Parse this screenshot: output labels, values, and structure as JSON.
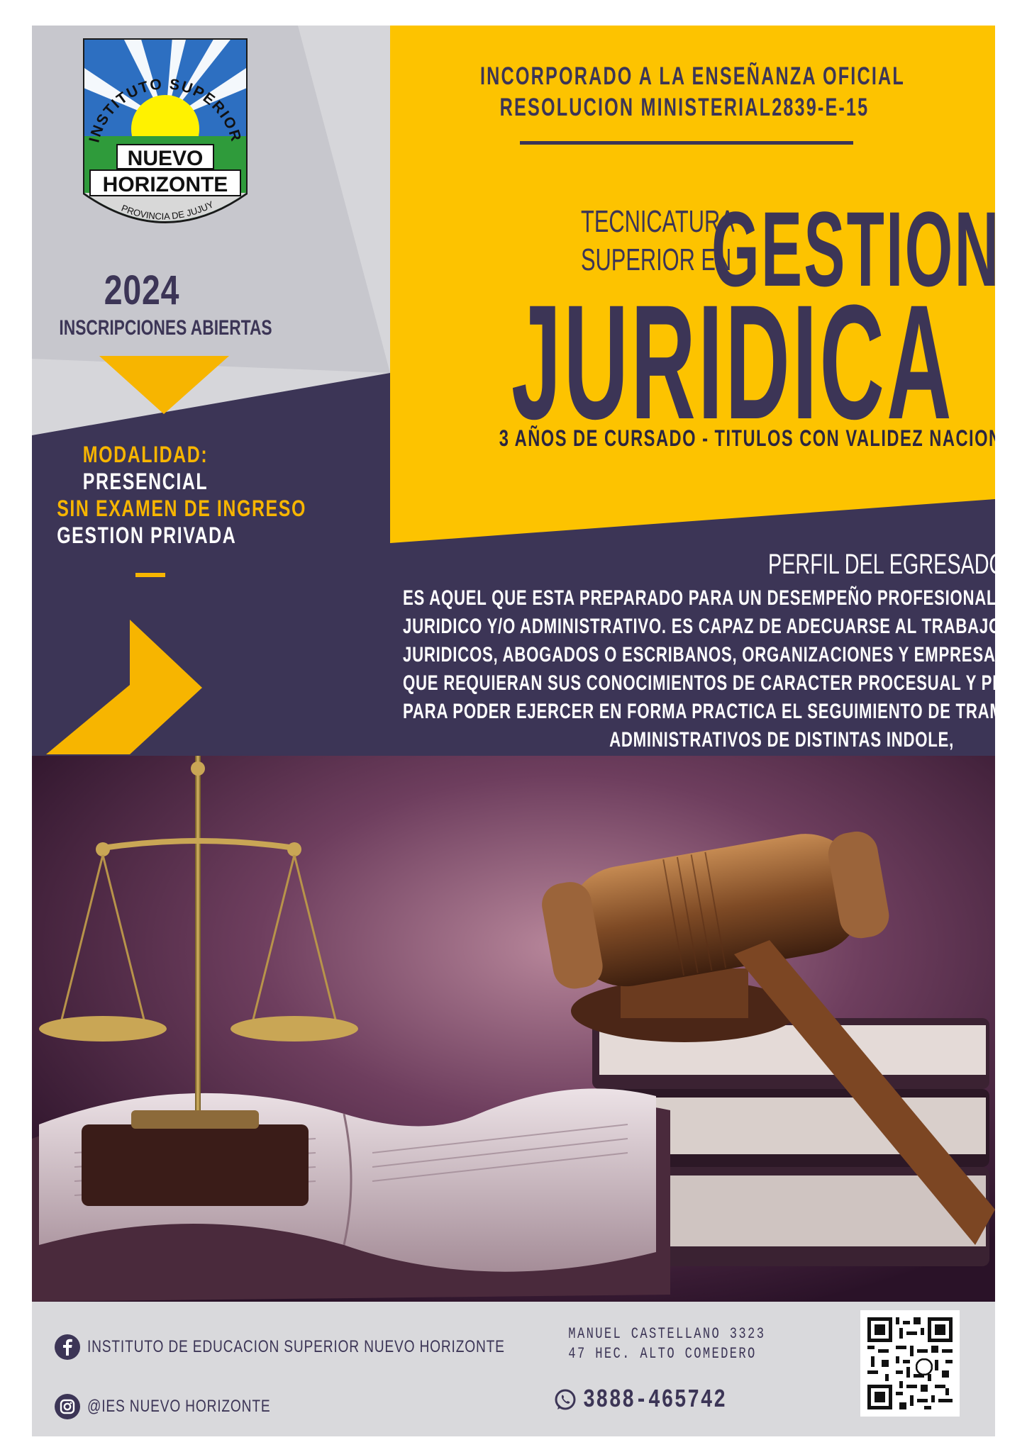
{
  "logo": {
    "arc_text": "INSTITUTO SUPERIOR",
    "name_line1": "NUEVO",
    "name_line2": "HORIZONTE",
    "province": "PROVINCIA DE JUJUY"
  },
  "left": {
    "year": "2024",
    "enrollment": "INSCRIPCIONES ABIERTAS",
    "modality_label": "MODALIDAD:",
    "modality_value": "PRESENCIAL",
    "no_exam": "SIN EXAMEN DE INGRESO",
    "management": "GESTION PRIVADA"
  },
  "header": {
    "official_line1": "INCORPORADO A LA ENSEÑANZA OFICIAL",
    "official_line2": "RESOLUCION MINISTERIAL2839-E-15",
    "tec_line1": "TECNICATURA",
    "tec_line2": "SUPERIOR EN",
    "title_word1": "GESTION",
    "title_word2": "JURIDICA",
    "duration_a": "3 AÑOS DE CURSADO - ",
    "duration_b": "TITULOS CON VALIDEZ NACIONAL"
  },
  "profile": {
    "title": "PERFIL DEL EGRESADO",
    "lines": [
      "ES AQUEL QUE ESTA PREPARADO PARA UN DESEMPEÑO PROFESIONAL EN EL AMBITO DE LO",
      "JURIDICO Y/O ADMINISTRATIVO. ES CAPAZ DE ADECUARSE AL TRABAJO DE ESTUDIOS",
      "JURIDICOS, ABOGADOS O ESCRIBANOS, ORGANIZACIONES Y EMPRESAS O PARTICULARES",
      "QUE REQUIERAN SUS CONOCIMIENTOS DE CARACTER PROCESUAL Y PRACTICO. CAPACITADO",
      "PARA PODER EJERCER EN FORMA PRACTICA EL SEGUIMIENTO DE TRAMITES JUDICIALES Y",
      "ADMINISTRATIVOS DE DISTINTAS INDOLE,"
    ]
  },
  "footer": {
    "facebook": "INSTITUTO DE EDUCACION SUPERIOR NUEVO HORIZONTE",
    "instagram": "@IES NUEVO HORIZONTE",
    "address_line1": "MANUEL CASTELLANO 3323",
    "address_line2": "47 HEC. ALTO COMEDERO",
    "phone": "3888-465742"
  },
  "colors": {
    "navy": "#3c3556",
    "yellow": "#fdc300",
    "gold": "#f7b500",
    "grey": "#d6d6da"
  },
  "icons": [
    "facebook-icon",
    "instagram-icon",
    "whatsapp-icon",
    "qr-code",
    "scales-of-justice",
    "gavel",
    "open-book"
  ]
}
